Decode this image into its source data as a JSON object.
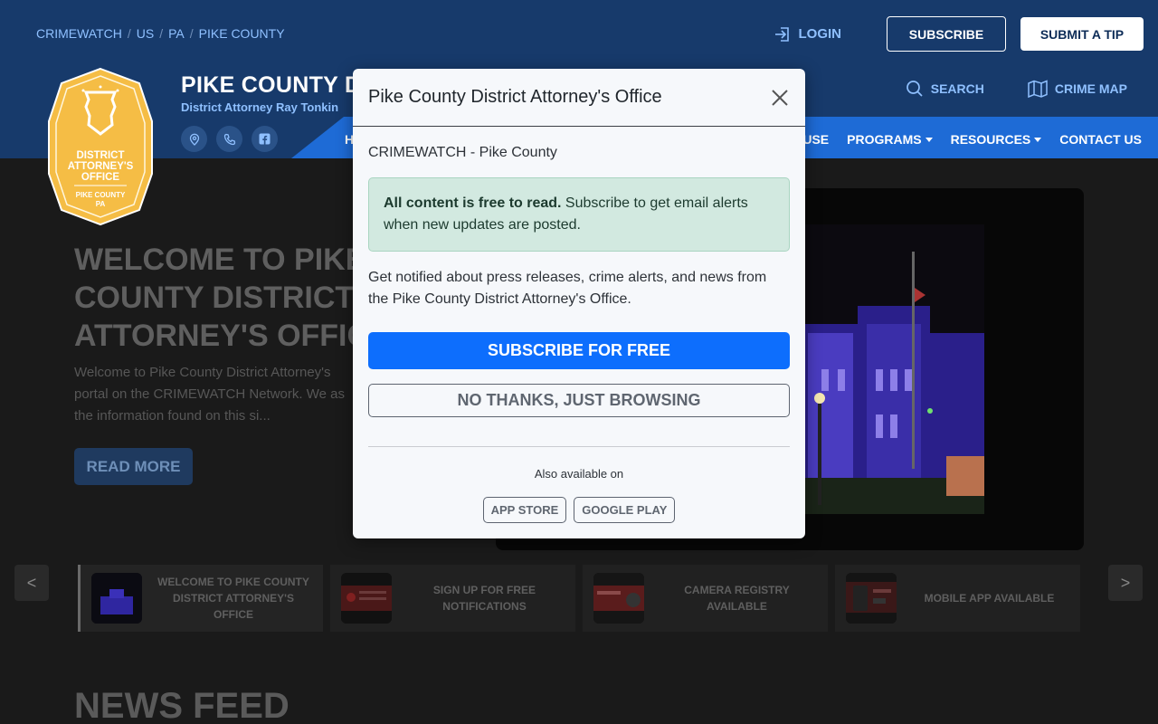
{
  "breadcrumb": [
    "CRIMEWATCH",
    "US",
    "PA",
    "PIKE COUNTY"
  ],
  "header": {
    "login_label": "LOGIN",
    "subscribe_label": "SUBSCRIBE",
    "submit_tip_label": "SUBMIT A TIP",
    "site_title": "PIKE COUNTY D",
    "site_subtitle": "District Attorney Ray Tonkin",
    "search_label": "SEARCH",
    "crime_map_label": "CRIME MAP"
  },
  "badge": {
    "line1": "DISTRICT",
    "line2": "ATTORNEY'S",
    "line3": "OFFICE",
    "line4": "PIKE COUNTY",
    "line5": "PA"
  },
  "nav": {
    "left_item": "H",
    "items": [
      {
        "label": "HOUSE",
        "dropdown": false
      },
      {
        "label": "PROGRAMS",
        "dropdown": true
      },
      {
        "label": "RESOURCES",
        "dropdown": true
      },
      {
        "label": "CONTACT US",
        "dropdown": false
      }
    ]
  },
  "hero": {
    "title_lines": [
      "WELCOME TO PIKE",
      "COUNTY DISTRICT",
      "ATTORNEY'S OFFIC"
    ],
    "text": "Welcome to Pike County District Attorney's portal on the CRIMEWATCH Network. We as the information found on this si...",
    "read_more_label": "READ MORE"
  },
  "carousel": {
    "prev_label": "<",
    "next_label": ">",
    "items": [
      {
        "label": "WELCOME TO PIKE COUNTY DISTRICT ATTORNEY'S OFFICE"
      },
      {
        "label": "SIGN UP FOR FREE NOTIFICATIONS"
      },
      {
        "label": "CAMERA REGISTRY AVAILABLE"
      },
      {
        "label": "MOBILE APP AVAILABLE"
      }
    ]
  },
  "news_feed_title": "NEWS FEED",
  "modal": {
    "title": "Pike County District Attorney's Office",
    "org": "CRIMEWATCH - Pike County",
    "alert_bold": "All content is free to read.",
    "alert_text": " Subscribe to get email alerts when new updates are posted.",
    "description": "Get notified about press releases, crime alerts, and news from the Pike County District Attorney's Office.",
    "subscribe_label": "SUBSCRIBE FOR FREE",
    "no_thanks_label": "NO THANKS, JUST BROWSING",
    "also_available": "Also available on",
    "app_store_label": "APP STORE",
    "google_play_label": "GOOGLE PLAY"
  },
  "colors": {
    "header_bg": "#173a6b",
    "nav_bg": "#1e6bd6",
    "link_blue": "#8fc0ff",
    "primary": "#0d6efd",
    "badge_gold": "#f5bd45"
  }
}
